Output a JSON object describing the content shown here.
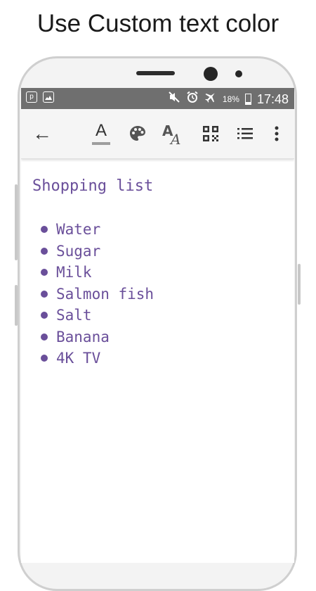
{
  "caption": "Use Custom text color",
  "status_bar": {
    "left_icons": [
      "p-notification-icon",
      "image-notification-icon"
    ],
    "right_icons": [
      "mute-icon",
      "alarm-icon",
      "airplane-icon"
    ],
    "battery_percent": "18%",
    "time": "17:48"
  },
  "toolbar": {
    "back_icon": "←",
    "text_color_letter": "A",
    "font_icon_label": "AA",
    "more_icon": "⋮"
  },
  "note": {
    "title": "Shopping list",
    "items": [
      "Water",
      "Sugar",
      "Milk",
      "Salmon fish",
      "Salt",
      "Banana",
      "4K TV"
    ]
  },
  "colors": {
    "text_color": "#6a4f9a",
    "status_bar": "#6f6f6f",
    "toolbar": "#f5f5f5"
  }
}
